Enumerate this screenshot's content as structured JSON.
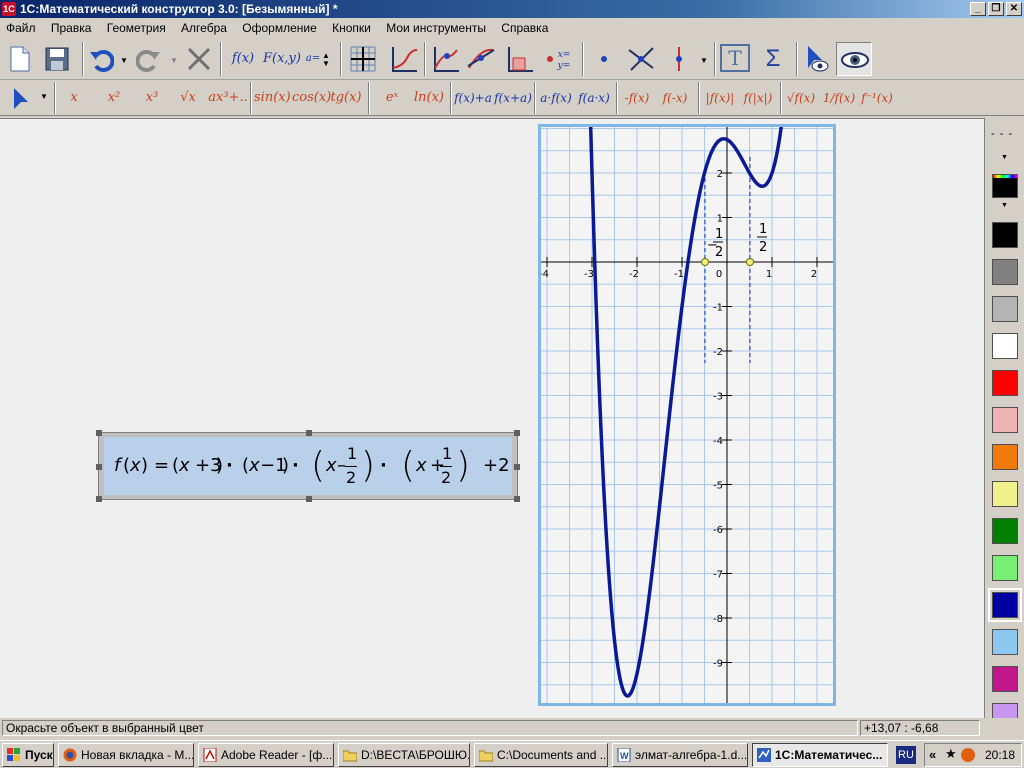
{
  "window": {
    "title": "1С:Математический конструктор 3.0: [Безымянный] *"
  },
  "menu": [
    "Файл",
    "Правка",
    "Геометрия",
    "Алгебра",
    "Оформление",
    "Кнопки",
    "Мои инструменты",
    "Справка"
  ],
  "toolbar1": {
    "fx": "f(x)",
    "fxy": "F(x,y)",
    "param": "a=",
    "eq": "x= y=",
    "text": "T",
    "sum": "Σ"
  },
  "toolbar2": [
    "x",
    "x²",
    "x³",
    "√x",
    "ax³+..",
    "sin(x)",
    "cos(x)",
    "tg(x)",
    "eˣ",
    "ln(x)",
    "f(x)+a",
    "f(x+a)",
    "a·f(x)",
    "f(a·x)",
    "-f(x)",
    "f(-x)",
    "|f(x)|",
    "f(|x|)",
    "√f(x)",
    "1/f(x)",
    "f⁻¹(x)"
  ],
  "formula": {
    "lhs_f": "f",
    "lhs_x": "x",
    "eq": "=",
    "x": "x",
    "p3": "+3",
    "m1": "−1",
    "minus": "–",
    "plus": "+",
    "one": "1",
    "two": "2",
    "c": "+2",
    "dot": "·"
  },
  "graph": {
    "xticks": [
      "-4",
      "-3",
      "-2",
      "-1",
      "0",
      "1",
      "2"
    ],
    "yticks": [
      "2",
      "1",
      "-1",
      "-2",
      "-3",
      "-4",
      "-5",
      "-6",
      "-7",
      "-8",
      "-9"
    ],
    "markers": {
      "left_num": "1",
      "left_den": "2",
      "left_sign": "−",
      "right_num": "1",
      "right_den": "2"
    },
    "curve_color": "#0a1a96"
  },
  "palette": {
    "line_style": "- - -",
    "colors": [
      "#000000",
      "#808080",
      "#b4b4b4",
      "#ffffff",
      "#ff0000",
      "#f0b4b4",
      "#f07a0a",
      "#f0f08c",
      "#008000",
      "#78f078",
      "#0000a0",
      "#8cc8f0",
      "#c0188c",
      "#c896f0"
    ]
  },
  "status": {
    "message": "Окрасьте объект в выбранный цвет",
    "coords": "+13,07 : -6,68"
  },
  "taskbar": {
    "start": "Пуск",
    "tasks": [
      "Новая вкладка - M...",
      "Adobe Reader - [ф...",
      "D:\\ВЕСТА\\БРОШЮ...",
      "C:\\Documents and ...",
      "элмат-алгебра-1.d...",
      "1С:Математичес..."
    ],
    "lang": "RU",
    "time": "20:18"
  }
}
